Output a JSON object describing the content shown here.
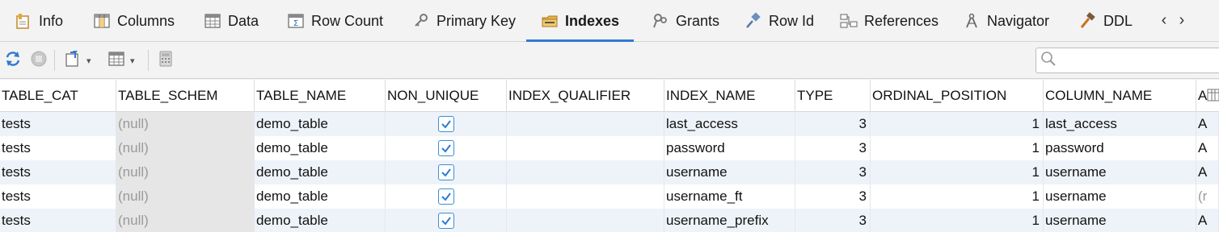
{
  "tabs": [
    {
      "label": "Info",
      "icon": "info-icon"
    },
    {
      "label": "Columns",
      "icon": "columns-icon"
    },
    {
      "label": "Data",
      "icon": "data-grid-icon"
    },
    {
      "label": "Row Count",
      "icon": "row-count-icon"
    },
    {
      "label": "Primary Key",
      "icon": "key-icon"
    },
    {
      "label": "Indexes",
      "icon": "indexes-icon",
      "active": true
    },
    {
      "label": "Grants",
      "icon": "grants-icon"
    },
    {
      "label": "Row Id",
      "icon": "row-id-icon"
    },
    {
      "label": "References",
      "icon": "references-icon"
    },
    {
      "label": "Navigator",
      "icon": "navigator-icon"
    },
    {
      "label": "DDL",
      "icon": "ddl-icon"
    }
  ],
  "tab_nav": {
    "prev": "‹",
    "next": "›"
  },
  "toolbar": {
    "buttons": [
      "refresh-icon",
      "stop-icon",
      "export-icon",
      "grid-view-icon",
      "calculator-icon"
    ],
    "search_placeholder": ""
  },
  "table": {
    "columns": [
      "TABLE_CAT",
      "TABLE_SCHEM",
      "TABLE_NAME",
      "NON_UNIQUE",
      "INDEX_QUALIFIER",
      "INDEX_NAME",
      "TYPE",
      "ORDINAL_POSITION",
      "COLUMN_NAME",
      "A"
    ],
    "rows": [
      {
        "table_cat": "tests",
        "table_schem": "(null)",
        "table_name": "demo_table",
        "non_unique": true,
        "index_qualifier": "",
        "index_name": "last_access",
        "type": "3",
        "ordinal_position": "1",
        "column_name": "last_access",
        "extra": "A"
      },
      {
        "table_cat": "tests",
        "table_schem": "(null)",
        "table_name": "demo_table",
        "non_unique": true,
        "index_qualifier": "",
        "index_name": "password",
        "type": "3",
        "ordinal_position": "1",
        "column_name": "password",
        "extra": "A"
      },
      {
        "table_cat": "tests",
        "table_schem": "(null)",
        "table_name": "demo_table",
        "non_unique": true,
        "index_qualifier": "",
        "index_name": "username",
        "type": "3",
        "ordinal_position": "1",
        "column_name": "username",
        "extra": "A"
      },
      {
        "table_cat": "tests",
        "table_schem": "(null)",
        "table_name": "demo_table",
        "non_unique": true,
        "index_qualifier": "",
        "index_name": "username_ft",
        "type": "3",
        "ordinal_position": "1",
        "column_name": "username",
        "extra": "(r"
      },
      {
        "table_cat": "tests",
        "table_schem": "(null)",
        "table_name": "demo_table",
        "non_unique": true,
        "index_qualifier": "",
        "index_name": "username_prefix",
        "type": "3",
        "ordinal_position": "1",
        "column_name": "username",
        "extra": "A"
      }
    ]
  },
  "colors": {
    "accent": "#2f7bd1",
    "null_bg": "#e6e6e6",
    "stripe": "#eef3f9"
  }
}
